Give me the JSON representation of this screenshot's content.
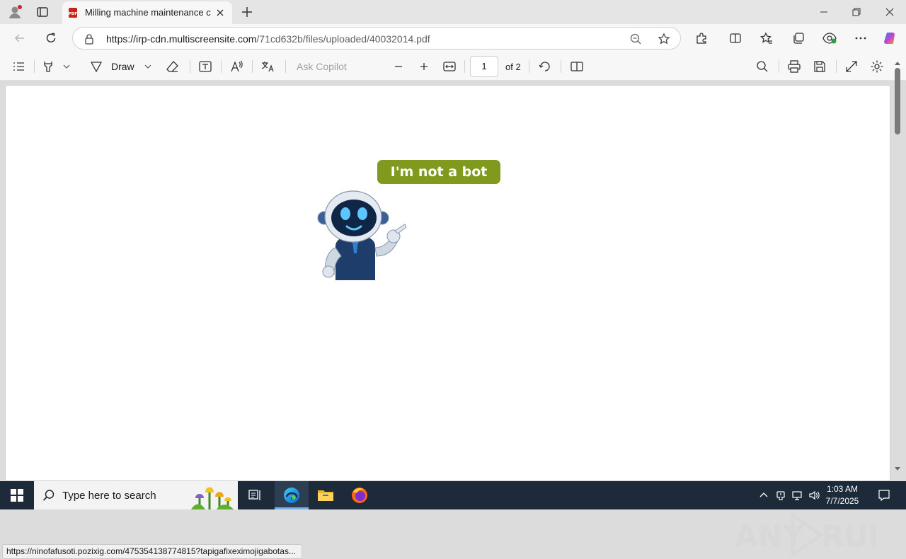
{
  "browser": {
    "tab_title": "Milling machine maintenance che",
    "url_host": "https://irp-cdn.multiscreensite.com",
    "url_path": "/71cd632b/files/uploaded/40032014.pdf",
    "tab_icon": "pdf-file-icon"
  },
  "pdf_toolbar": {
    "draw_label": "Draw",
    "ask_copilot": "Ask Copilot",
    "page_number": "1",
    "page_total": "of 2"
  },
  "document": {
    "button_label": "I'm not a bot"
  },
  "status": {
    "link_url": "https://ninofafusoti.pozixig.com/475354138774815?tapigafixeximojigabotas..."
  },
  "taskbar": {
    "search_placeholder": "Type here to search",
    "time": "1:03 AM",
    "date": "7/7/2025"
  },
  "watermark": {
    "text": "ANY RUN"
  },
  "colors": {
    "button_bg": "#7f9a1d",
    "taskbar_bg": "#1c2a3a",
    "accent": "#0a64d8"
  }
}
